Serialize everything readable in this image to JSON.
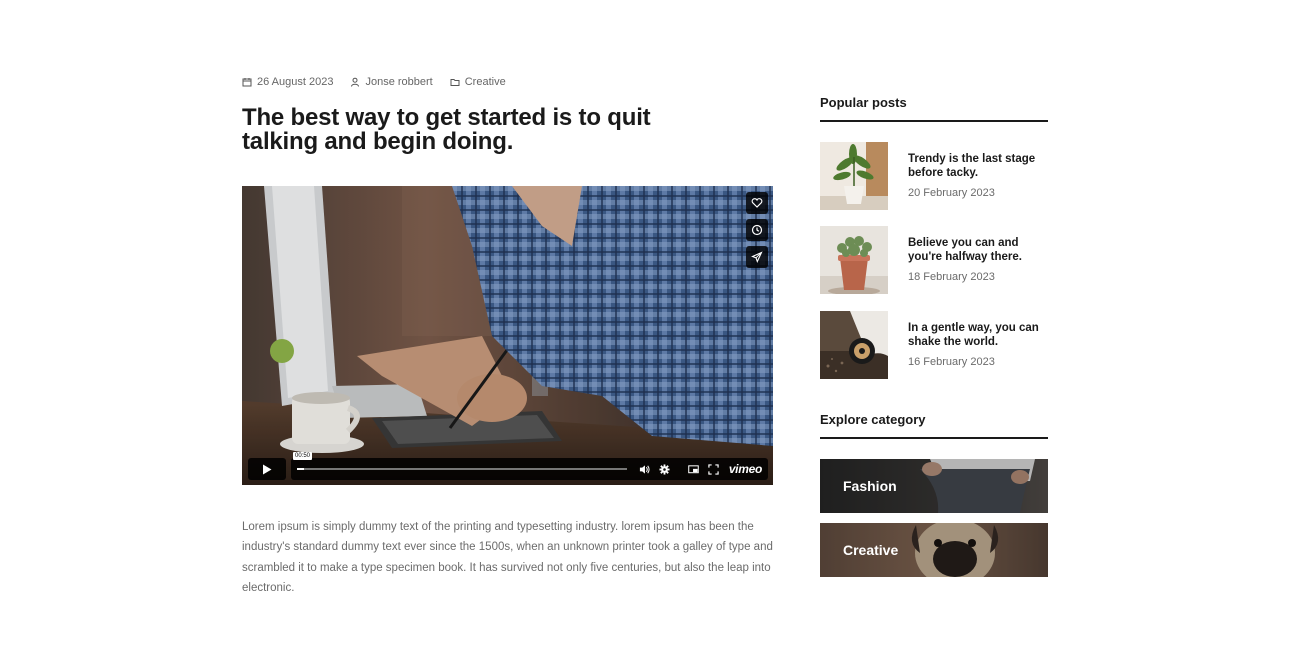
{
  "article": {
    "date": "26 August 2023",
    "author": "Jonse robbert",
    "category": "Creative",
    "title": "The best way to get started is to quit talking and begin doing.",
    "body": "Lorem ipsum is simply dummy text of the printing and typesetting industry. lorem ipsum has been the industry's standard dummy text ever since the 1500s, when an unknown printer took a galley of type and scrambled it to make a type specimen book. It has survived not only five centuries, but also the leap into electronic."
  },
  "video": {
    "time": "00:50",
    "progress": 0.02,
    "brand": "vimeo",
    "side_icons": [
      "heart-icon",
      "clock-icon",
      "send-icon"
    ],
    "control_icons": [
      "play-icon",
      "volume-icon",
      "settings-icon",
      "pip-icon",
      "fullscreen-icon"
    ]
  },
  "sidebar": {
    "popular_heading": "Popular posts",
    "posts": [
      {
        "title": "Trendy is the last stage before tacky.",
        "date": "20 February 2023"
      },
      {
        "title": "Believe you can and you're halfway there.",
        "date": "18 February 2023"
      },
      {
        "title": "In a gentle way, you can shake the world.",
        "date": "16 February 2023"
      }
    ],
    "category_heading": "Explore category",
    "categories": [
      {
        "label": "Fashion"
      },
      {
        "label": "Creative"
      }
    ]
  }
}
